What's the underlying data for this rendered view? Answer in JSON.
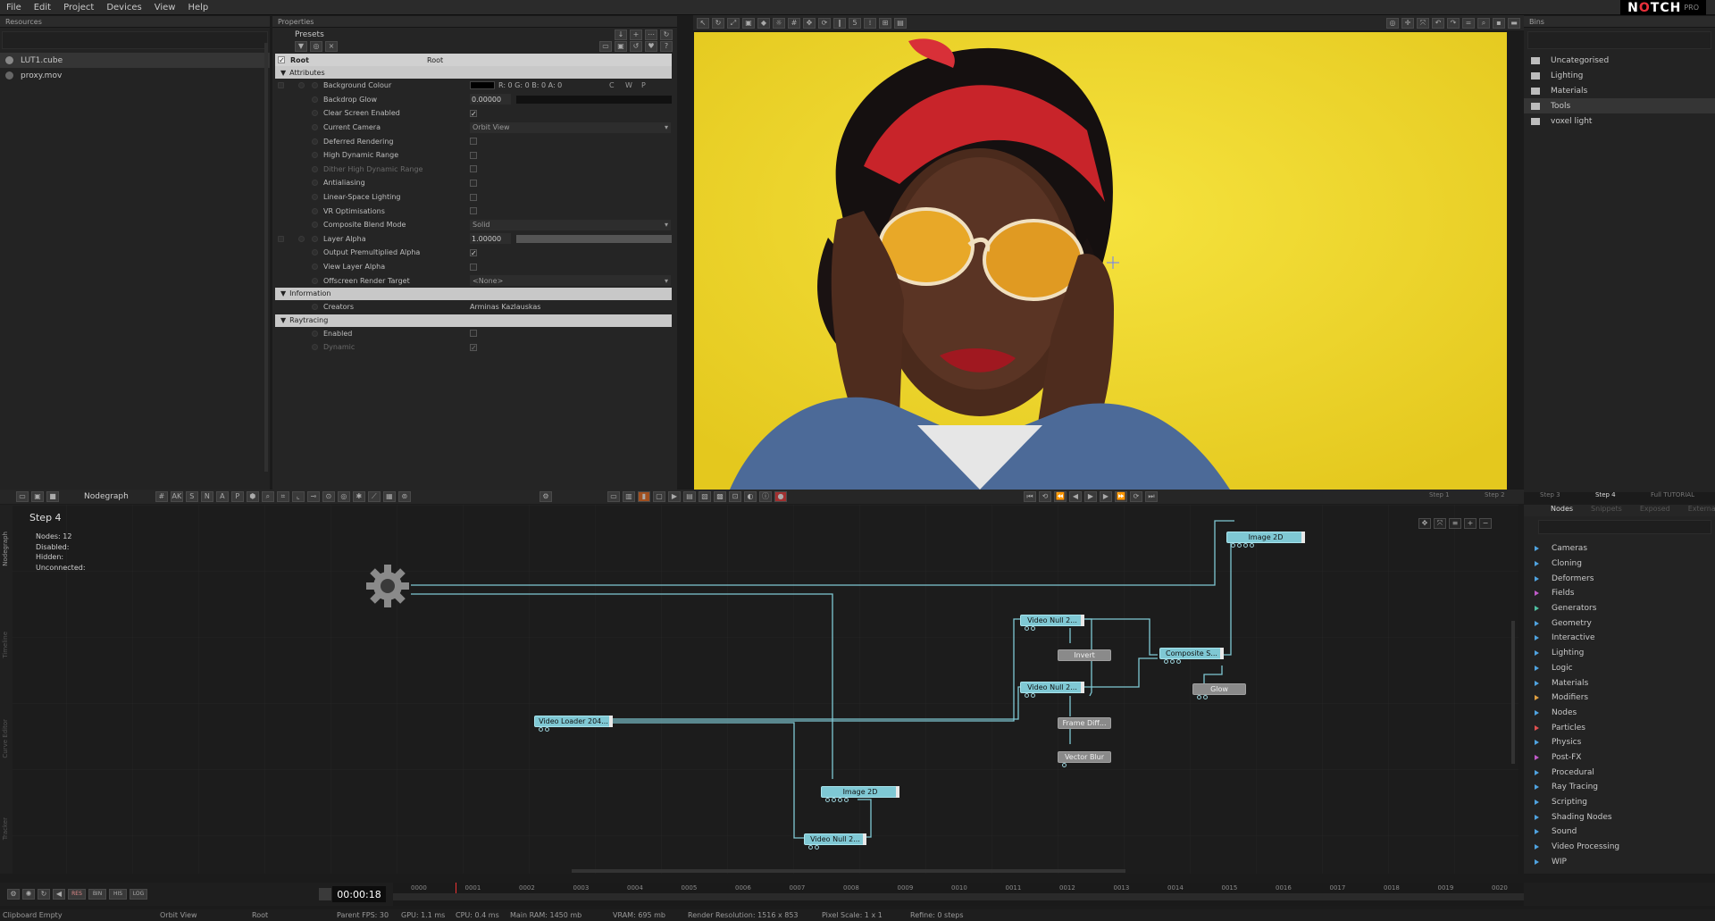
{
  "menu": [
    "File",
    "Edit",
    "Project",
    "Devices",
    "View",
    "Help"
  ],
  "logo": {
    "brand_pre": "N",
    "brand_mark": "O",
    "brand_post": "TCH",
    "edition": "PRO"
  },
  "resources": {
    "title": "Resources",
    "items": [
      {
        "label": "LUT1.cube"
      },
      {
        "label": "proxy.mov"
      }
    ]
  },
  "properties": {
    "title": "Properties",
    "presets_label": "Presets",
    "root_label": "Root",
    "root_value": "Root",
    "attributes_label": "Attributes",
    "rows": [
      {
        "label": "Background Colour",
        "value": "R: 0 G: 0 B: 0 A: 0",
        "type": "color",
        "extra": [
          "C",
          "W",
          "P"
        ]
      },
      {
        "label": "Backdrop Glow",
        "value": "0.00000",
        "type": "slider",
        "fill": 0.0
      },
      {
        "label": "Clear Screen Enabled",
        "value": "✓",
        "type": "check"
      },
      {
        "label": "Current Camera",
        "value": "Orbit View",
        "type": "select"
      },
      {
        "label": "Deferred Rendering",
        "value": "",
        "type": "check"
      },
      {
        "label": "High Dynamic Range",
        "value": "",
        "type": "check"
      },
      {
        "label": "Dither High Dynamic Range",
        "value": "",
        "type": "check",
        "dim": true
      },
      {
        "label": "Antialiasing",
        "value": "",
        "type": "check"
      },
      {
        "label": "Linear-Space Lighting",
        "value": "",
        "type": "check"
      },
      {
        "label": "VR Optimisations",
        "value": "",
        "type": "check"
      },
      {
        "label": "Composite Blend Mode",
        "value": "Solid",
        "type": "select"
      },
      {
        "label": "Layer Alpha",
        "value": "1.00000",
        "type": "slider",
        "fill": 1.0
      },
      {
        "label": "Output Premultiplied Alpha",
        "value": "✓",
        "type": "check"
      },
      {
        "label": "View Layer Alpha",
        "value": "",
        "type": "check"
      },
      {
        "label": "Offscreen Render Target",
        "value": "<None>",
        "type": "select"
      }
    ],
    "information_label": "Information",
    "creators_label": "Creators",
    "creators_value": "Arminas Kazlauskas",
    "raytracing_label": "Raytracing",
    "ray_rows": [
      {
        "label": "Enabled",
        "value": "",
        "dim": false
      },
      {
        "label": "Dynamic",
        "value": "✓",
        "dim": true
      }
    ]
  },
  "viewport": {
    "toolbar_number": "5"
  },
  "bins": {
    "title": "Bins",
    "items": [
      {
        "label": "Uncategorised"
      },
      {
        "label": "Lighting"
      },
      {
        "label": "Materials"
      },
      {
        "label": "Tools"
      },
      {
        "label": "voxel light"
      }
    ]
  },
  "nodegraph": {
    "tab_label": "Nodegraph",
    "snap_letters": [
      "AK",
      "S",
      "N",
      "A",
      "P"
    ],
    "step_title": "Step  4",
    "stats": [
      {
        "label": "Nodes:",
        "value": "12"
      },
      {
        "label": "Disabled:",
        "value": ""
      },
      {
        "label": "Hidden:",
        "value": ""
      },
      {
        "label": "Unconnected:",
        "value": ""
      }
    ],
    "side_tabs": [
      "Nodegraph",
      "Timeline",
      "Curve Editor",
      "Tracker"
    ],
    "nodes": [
      {
        "id": "image2d_top",
        "label": "Image  2D",
        "color": "cyan"
      },
      {
        "id": "videonull_1",
        "label": "Video  Null  2...",
        "color": "cyan"
      },
      {
        "id": "invert",
        "label": "Invert",
        "color": "gray"
      },
      {
        "id": "composite",
        "label": "Composite  S...",
        "color": "cyan"
      },
      {
        "id": "glow",
        "label": "Glow",
        "color": "gray"
      },
      {
        "id": "videonull_2",
        "label": "Video  Null  2...",
        "color": "cyan"
      },
      {
        "id": "framediff",
        "label": "Frame  Diff...",
        "color": "gray"
      },
      {
        "id": "vectorblur",
        "label": "Vector  Blur",
        "color": "gray"
      },
      {
        "id": "videoloader",
        "label": "Video  Loader  204...",
        "color": "cyan"
      },
      {
        "id": "image2d_bottom",
        "label": "Image  2D",
        "color": "cyan"
      },
      {
        "id": "videonull_3",
        "label": "Video  Null  2...",
        "color": "cyan"
      }
    ],
    "steps": [
      "Step 1",
      "Step 2",
      "Step 3",
      "Step 4",
      "Full TUTORIAL"
    ]
  },
  "nodes_panel": {
    "tabs": [
      "Nodes",
      "Snippets",
      "Exposed",
      "External"
    ],
    "items": [
      {
        "label": "Cameras",
        "color": "#4fa3e0"
      },
      {
        "label": "Cloning",
        "color": "#4fa3e0"
      },
      {
        "label": "Deformers",
        "color": "#4fa3e0"
      },
      {
        "label": "Fields",
        "color": "#c05ac8"
      },
      {
        "label": "Generators",
        "color": "#4fc0a0"
      },
      {
        "label": "Geometry",
        "color": "#4fa3e0"
      },
      {
        "label": "Interactive",
        "color": "#4fa3e0"
      },
      {
        "label": "Lighting",
        "color": "#4fa3e0"
      },
      {
        "label": "Logic",
        "color": "#4fa3e0"
      },
      {
        "label": "Materials",
        "color": "#4fa3e0"
      },
      {
        "label": "Modifiers",
        "color": "#e0a040"
      },
      {
        "label": "Nodes",
        "color": "#4fa3e0"
      },
      {
        "label": "Particles",
        "color": "#e05050"
      },
      {
        "label": "Physics",
        "color": "#4fa3e0"
      },
      {
        "label": "Post-FX",
        "color": "#c05ac8"
      },
      {
        "label": "Procedural",
        "color": "#4fa3e0"
      },
      {
        "label": "Ray Tracing",
        "color": "#4fa3e0"
      },
      {
        "label": "Scripting",
        "color": "#4fa3e0"
      },
      {
        "label": "Shading Nodes",
        "color": "#4fa3e0"
      },
      {
        "label": "Sound",
        "color": "#4fa3e0"
      },
      {
        "label": "Video Processing",
        "color": "#4fa3e0"
      },
      {
        "label": "WIP",
        "color": "#4fa3e0"
      }
    ]
  },
  "timeline": {
    "time": "00:00:18",
    "buttons": [
      "RES",
      "BIN",
      "HIS",
      "LOG"
    ],
    "ticks": [
      "0000",
      "0001",
      "0002",
      "0003",
      "0004",
      "0005",
      "0006",
      "0007",
      "0008",
      "0009",
      "0010",
      "0011",
      "0012",
      "0013",
      "0014",
      "0015",
      "0016",
      "0017",
      "0018",
      "0019",
      "0020"
    ]
  },
  "status": {
    "clipboard": "Clipboard Empty",
    "camera": "Orbit View",
    "layer": "Root",
    "fps": "Parent  FPS: 30",
    "gpu": "GPU: 1.1 ms",
    "cpu": "CPU: 0.4 ms",
    "ram": "Main RAM: 1450 mb",
    "vram": "VRAM: 695 mb",
    "resolution": "Render Resolution: 1516 x 853",
    "pixel_scale": "Pixel Scale: 1 x 1",
    "refine": "Refine: 0 steps"
  },
  "colors": {
    "viewport_bg": "#f0d92a",
    "node_cyan": "#7fc8d4",
    "node_gray": "#8a8a8a",
    "accent_red": "#e8303a"
  }
}
